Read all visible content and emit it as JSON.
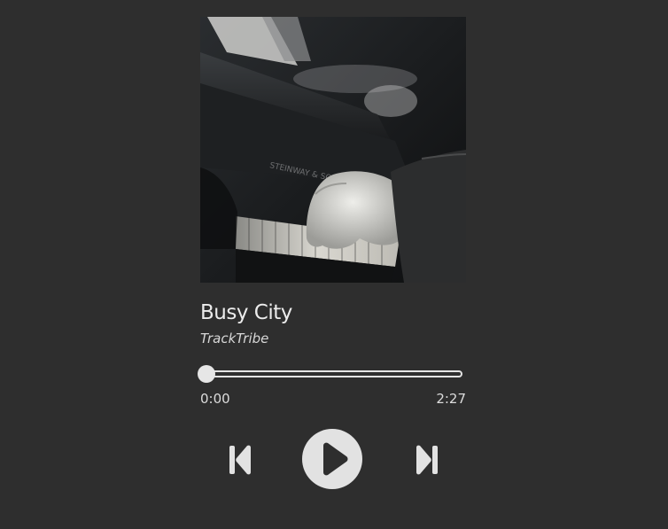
{
  "track": {
    "title": "Busy City",
    "artist": "TrackTribe"
  },
  "progress": {
    "current_time": "0:00",
    "duration": "2:27",
    "fraction": 0
  },
  "controls": {
    "previous_icon": "skip-previous-icon",
    "play_icon": "play-icon",
    "next_icon": "skip-next-icon"
  },
  "colors": {
    "background": "#2e2e2e",
    "foreground": "#e6e6e6"
  }
}
